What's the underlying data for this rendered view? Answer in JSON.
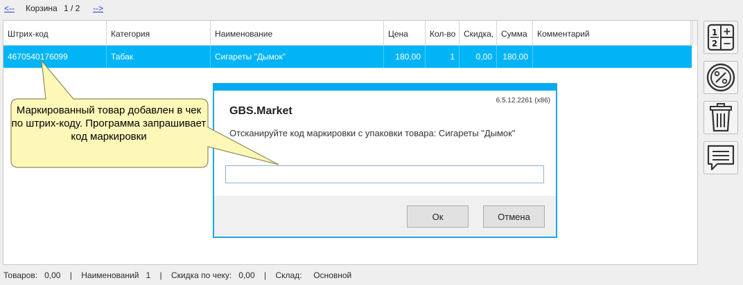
{
  "nav": {
    "prev": "<--",
    "cart_label": "Корзина",
    "page": "1 / 2",
    "next": "-->"
  },
  "grid": {
    "columns": [
      "Штрих-код",
      "Категория",
      "Наименование",
      "Цена",
      "Кол-во",
      "Скидка,",
      "Сумма",
      "Комментарий"
    ],
    "rows": [
      {
        "barcode": "4670540176099",
        "category": "Табак",
        "name": "Сигареты \"Дымок\"",
        "price": "180,00",
        "qty": "1",
        "discount": "0,00",
        "sum": "180,00",
        "comment": ""
      }
    ]
  },
  "toolbar": {
    "items": [
      {
        "icon": "calculator-icon"
      },
      {
        "icon": "discount-percent-icon"
      },
      {
        "icon": "trash-icon"
      },
      {
        "icon": "comment-icon"
      }
    ]
  },
  "callout": {
    "text": "Маркированный товар добавлен в чек по штрих-коду. Программа запрашивает код маркировки"
  },
  "dialog": {
    "version": "6.5.12.2261 (x86)",
    "title": "GBS.Market",
    "message": "Отсканируйте код маркировки с упаковки товара: Сигареты \"Дымок\"",
    "input_value": "",
    "ok_label": "Ок",
    "cancel_label": "Отмена",
    "accent_color": "#00aaf0"
  },
  "status": {
    "items_label": "Товаров:",
    "items_value": "0,00",
    "names_label": "Наименований",
    "names_value": "1",
    "receipt_discount_label": "Скидка по чеку:",
    "receipt_discount_value": "0,00",
    "warehouse_label": "Склад:",
    "warehouse_value": "Основной",
    "separator": "|"
  },
  "colors": {
    "selected_row": "#00b4f5",
    "callout_fill": "#fdf8b8",
    "link": "#1a3bd4"
  }
}
